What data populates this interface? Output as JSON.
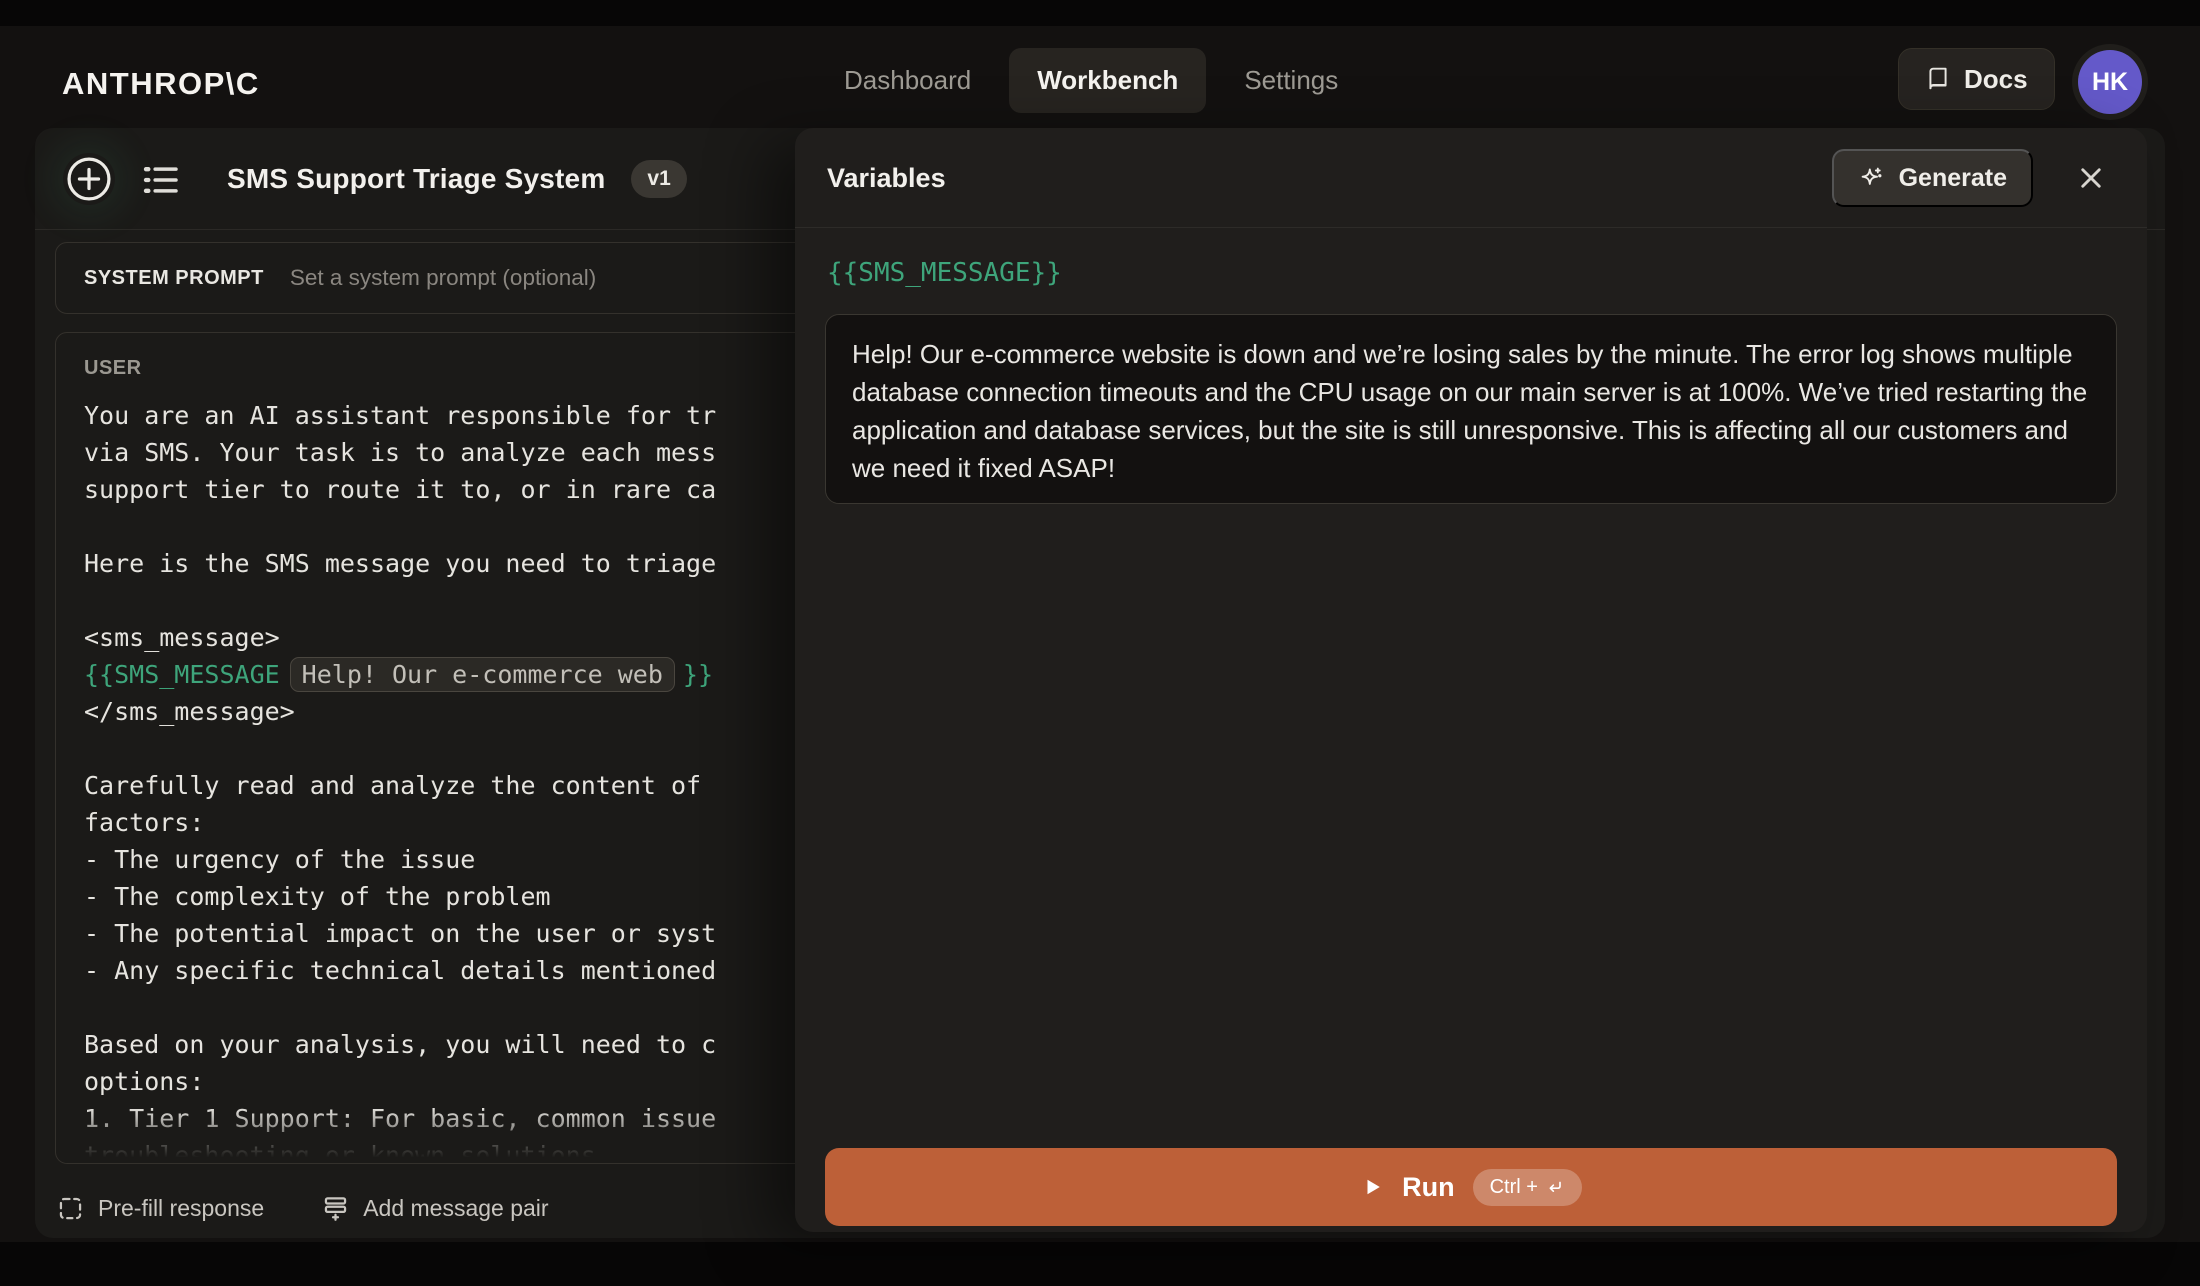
{
  "nav": {
    "logo": "ANTHROP\\C",
    "tabs": [
      {
        "label": "Dashboard",
        "active": false
      },
      {
        "label": "Workbench",
        "active": true
      },
      {
        "label": "Settings",
        "active": false
      }
    ],
    "docs_button": "Docs",
    "avatar_initials": "HK"
  },
  "prompt_panel": {
    "title": "SMS Support Triage System",
    "version_badge": "v1",
    "system_prompt_label": "SYSTEM PROMPT",
    "system_prompt_placeholder": "Set a system prompt (optional)",
    "user_role_label": "USER",
    "user_message_lines": [
      {
        "kind": "text",
        "text": "You are an AI assistant responsible for tr"
      },
      {
        "kind": "text",
        "text": "via SMS. Your task is to analyze each mess"
      },
      {
        "kind": "text",
        "text": "support tier to route it to, or in rare ca"
      },
      {
        "kind": "text",
        "text": ""
      },
      {
        "kind": "text",
        "text": "Here is the SMS message you need to triage"
      },
      {
        "kind": "text",
        "text": ""
      },
      {
        "kind": "text",
        "text": "<sms_message>"
      },
      {
        "kind": "variable",
        "open": "{{SMS_MESSAGE",
        "preview": "Help! Our e-commerce web",
        "close": "}}"
      },
      {
        "kind": "text",
        "text": "</sms_message>"
      },
      {
        "kind": "text",
        "text": ""
      },
      {
        "kind": "text",
        "text": "Carefully read and analyze the content of"
      },
      {
        "kind": "text",
        "text": "factors:"
      },
      {
        "kind": "text",
        "text": "- The urgency of the issue"
      },
      {
        "kind": "text",
        "text": "- The complexity of the problem"
      },
      {
        "kind": "text",
        "text": "- The potential impact on the user or syst"
      },
      {
        "kind": "text",
        "text": "- Any specific technical details mentioned"
      },
      {
        "kind": "text",
        "text": ""
      },
      {
        "kind": "text",
        "text": "Based on your analysis, you will need to c"
      },
      {
        "kind": "text",
        "text": "options:"
      },
      {
        "kind": "text",
        "text": "1. Tier 1 Support: For basic, common issue"
      },
      {
        "kind": "text",
        "text": "troubleshooting or known solutions."
      }
    ],
    "prefill_button": "Pre-fill response",
    "add_pair_button": "Add message pair"
  },
  "variables_panel": {
    "title": "Variables",
    "generate_button": "Generate",
    "variable_name": "{{SMS_MESSAGE}}",
    "variable_value": "Help! Our e-commerce website is down and we’re losing sales by the minute. The error log shows multiple database connection timeouts and the CPU usage on our main server is at 100%. We’ve tried restarting the application and database services, but the site is still unresponsive. This is affecting all our customers and we need it fixed ASAP!",
    "run_button": "Run",
    "run_shortcut_prefix": "Ctrl +",
    "run_shortcut_icon": "return-key-icon"
  },
  "colors": {
    "accent_green": "#3EA57B",
    "run_orange": "#BD6038",
    "avatar_purple": "#6459C9"
  }
}
